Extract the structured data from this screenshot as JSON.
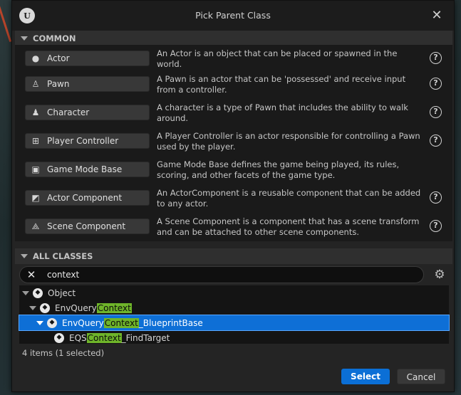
{
  "dialog": {
    "title": "Pick Parent Class",
    "logo_icon": "unreal-logo-icon",
    "close_icon": "close-icon"
  },
  "common": {
    "header": "COMMON",
    "classes": [
      {
        "label": "Actor",
        "icon": "actor-sphere-icon",
        "description": "An Actor is an object that can be placed or spawned in the world."
      },
      {
        "label": "Pawn",
        "icon": "pawn-icon",
        "description": "A Pawn is an actor that can be 'possessed' and receive input from a controller."
      },
      {
        "label": "Character",
        "icon": "character-icon",
        "description": "A character is a type of Pawn that includes the ability to walk around."
      },
      {
        "label": "Player Controller",
        "icon": "gamepad-icon",
        "description": "A Player Controller is an actor responsible for controlling a Pawn used by the player."
      },
      {
        "label": "Game Mode Base",
        "icon": "game-mode-icon",
        "description": "Game Mode Base defines the game being played, its rules, scoring, and other facets of the game type."
      },
      {
        "label": "Actor Component",
        "icon": "actor-component-icon",
        "description": "An ActorComponent is a reusable component that can be added to any actor."
      },
      {
        "label": "Scene Component",
        "icon": "scene-component-icon",
        "description": "A Scene Component is a component that has a scene transform and can be attached to other scene components."
      }
    ]
  },
  "all_classes": {
    "header": "ALL CLASSES",
    "search": {
      "value": "context",
      "clear_icon": "clear-search-icon",
      "settings_icon": "gear-icon"
    },
    "tree": [
      {
        "prefix": "Object",
        "match": "",
        "suffix": "",
        "depth": 0,
        "expandable": true,
        "selected": false
      },
      {
        "prefix": "EnvQuery",
        "match": "Context",
        "suffix": "",
        "depth": 1,
        "expandable": true,
        "selected": false
      },
      {
        "prefix": "EnvQuery",
        "match": "Context",
        "suffix": "_BlueprintBase",
        "depth": 2,
        "expandable": true,
        "selected": true
      },
      {
        "prefix": "EQS",
        "match": "Context",
        "suffix": "_FindTarget",
        "depth": 3,
        "expandable": false,
        "selected": false
      }
    ],
    "status": "4 items (1 selected)"
  },
  "footer": {
    "select_label": "Select",
    "cancel_label": "Cancel"
  },
  "colors": {
    "accent": "#0e6fd6",
    "highlight": "#6fb52a",
    "dialog_bg": "#242424"
  }
}
